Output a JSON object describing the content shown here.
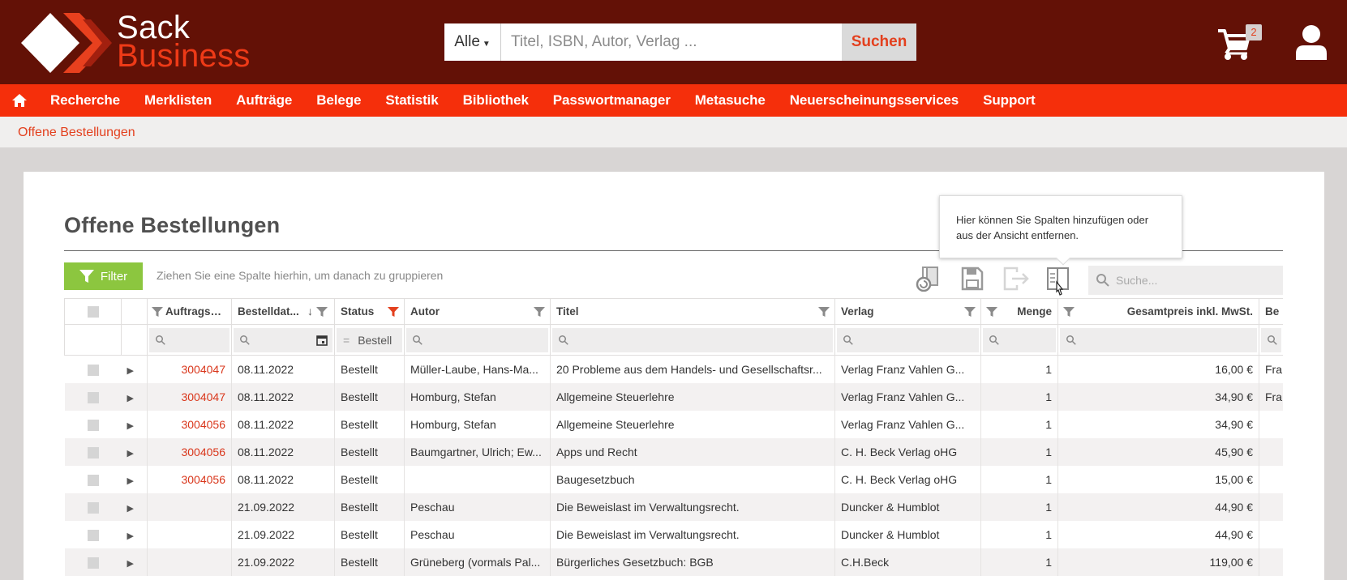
{
  "brand": {
    "line1": "Sack",
    "line2": "Business"
  },
  "search": {
    "scope": "Alle",
    "placeholder": "Titel, ISBN, Autor, Verlag ...",
    "button": "Suchen"
  },
  "cart": {
    "count": "2"
  },
  "nav": {
    "items": [
      "Recherche",
      "Merklisten",
      "Aufträge",
      "Belege",
      "Statistik",
      "Bibliothek",
      "Passwortmanager",
      "Metasuche",
      "Neuerscheinungsservices",
      "Support"
    ]
  },
  "breadcrumb": "Offene Bestellungen",
  "page": {
    "title": "Offene Bestellungen",
    "filter_label": "Filter",
    "group_hint": "Ziehen Sie eine Spalte hierhin, um danach zu gruppieren",
    "grid_search_placeholder": "Suche..."
  },
  "tooltip": "Hier können Sie Spalten hinzufügen oder aus der Ansicht entfernen.",
  "columns": [
    "Auftragsn...",
    "Bestelldat...",
    "Status",
    "Autor",
    "Titel",
    "Verlag",
    "Menge",
    "Gesamtpreis inkl. MwSt.",
    "Be"
  ],
  "status_filter_value": "Bestell",
  "rows": [
    {
      "order": "3004047",
      "date": "08.11.2022",
      "status": "Bestellt",
      "author": "Müller-Laube, Hans-Ma...",
      "title": "20 Probleme aus dem Handels- und Gesellschaftsr...",
      "publisher": "Verlag Franz Vahlen G...",
      "qty": "1",
      "price": "16,00 €",
      "extra": "Fra"
    },
    {
      "order": "3004047",
      "date": "08.11.2022",
      "status": "Bestellt",
      "author": "Homburg, Stefan",
      "title": "Allgemeine Steuerlehre",
      "publisher": "Verlag Franz Vahlen G...",
      "qty": "1",
      "price": "34,90 €",
      "extra": "Fra"
    },
    {
      "order": "3004056",
      "date": "08.11.2022",
      "status": "Bestellt",
      "author": "Homburg, Stefan",
      "title": "Allgemeine Steuerlehre",
      "publisher": "Verlag Franz Vahlen G...",
      "qty": "1",
      "price": "34,90 €",
      "extra": ""
    },
    {
      "order": "3004056",
      "date": "08.11.2022",
      "status": "Bestellt",
      "author": "Baumgartner, Ulrich; Ew...",
      "title": "Apps und Recht",
      "publisher": "C. H. Beck Verlag oHG",
      "qty": "1",
      "price": "45,90 €",
      "extra": ""
    },
    {
      "order": "3004056",
      "date": "08.11.2022",
      "status": "Bestellt",
      "author": "",
      "title": "Baugesetzbuch",
      "publisher": "C. H. Beck Verlag oHG",
      "qty": "1",
      "price": "15,00 €",
      "extra": ""
    },
    {
      "order": "",
      "date": "21.09.2022",
      "status": "Bestellt",
      "author": "Peschau",
      "title": "Die Beweislast im Verwaltungsrecht.",
      "publisher": "Duncker & Humblot",
      "qty": "1",
      "price": "44,90 €",
      "extra": ""
    },
    {
      "order": "",
      "date": "21.09.2022",
      "status": "Bestellt",
      "author": "Peschau",
      "title": "Die Beweislast im Verwaltungsrecht.",
      "publisher": "Duncker & Humblot",
      "qty": "1",
      "price": "44,90 €",
      "extra": ""
    },
    {
      "order": "",
      "date": "21.09.2022",
      "status": "Bestellt",
      "author": "Grüneberg (vormals Pal...",
      "title": "Bürgerliches Gesetzbuch: BGB",
      "publisher": "C.H.Beck",
      "qty": "1",
      "price": "119,00 €",
      "extra": ""
    }
  ]
}
